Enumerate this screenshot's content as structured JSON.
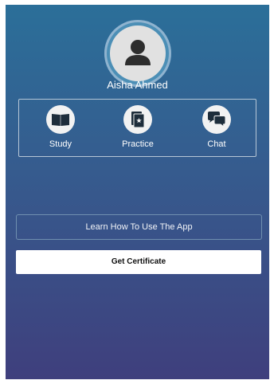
{
  "profile": {
    "name": "Aisha Ahmed",
    "avatar_icon": "user-silhouette-icon"
  },
  "menu": {
    "items": [
      {
        "label": "Study",
        "icon": "open-book-icon"
      },
      {
        "label": "Practice",
        "icon": "stacked-cards-star-icon"
      },
      {
        "label": "Chat",
        "icon": "chat-bubbles-icon"
      }
    ]
  },
  "actions": {
    "learn_label": "Learn How To Use The App",
    "certificate_label": "Get Certificate"
  },
  "colors": {
    "background_top": "#2b6f99",
    "background_bottom": "#3f3f7d",
    "icon_glyph": "#1e2d3b",
    "icon_circle": "#f2f2f2",
    "certificate_button": "#ffffff"
  }
}
